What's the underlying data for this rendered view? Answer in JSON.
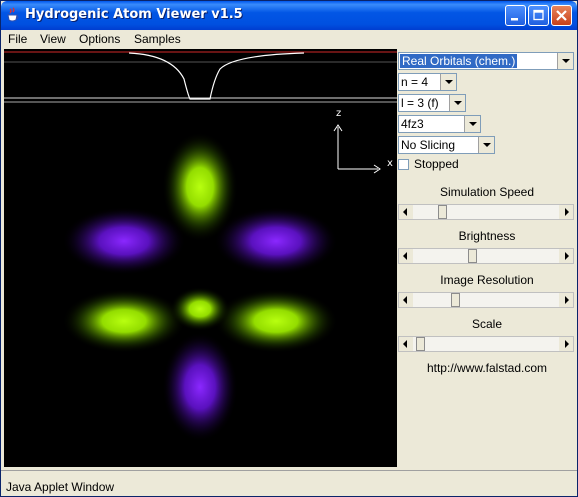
{
  "window": {
    "title": "Hydrogenic Atom Viewer v1.5",
    "status": "Java Applet Window"
  },
  "menu": [
    "File",
    "View",
    "Options",
    "Samples"
  ],
  "controls": {
    "view_mode": "Real Orbitals (chem.)",
    "n": "n = 4",
    "l": "l = 3 (f)",
    "orbital": "4fz3",
    "slicing": "No Slicing",
    "stopped_label": "Stopped",
    "stopped_checked": false
  },
  "sliders": [
    {
      "label": "Simulation Speed",
      "value": 0.18
    },
    {
      "label": "Brightness",
      "value": 0.4
    },
    {
      "label": "Image Resolution",
      "value": 0.28
    },
    {
      "label": "Scale",
      "value": 0.02
    }
  ],
  "axes": {
    "z": "z",
    "x": "x"
  },
  "url": "http://www.falstad.com",
  "colors": {
    "lobe_positive": "#a8ff00",
    "lobe_negative": "#7a18ff",
    "selection": "#316ac5"
  }
}
